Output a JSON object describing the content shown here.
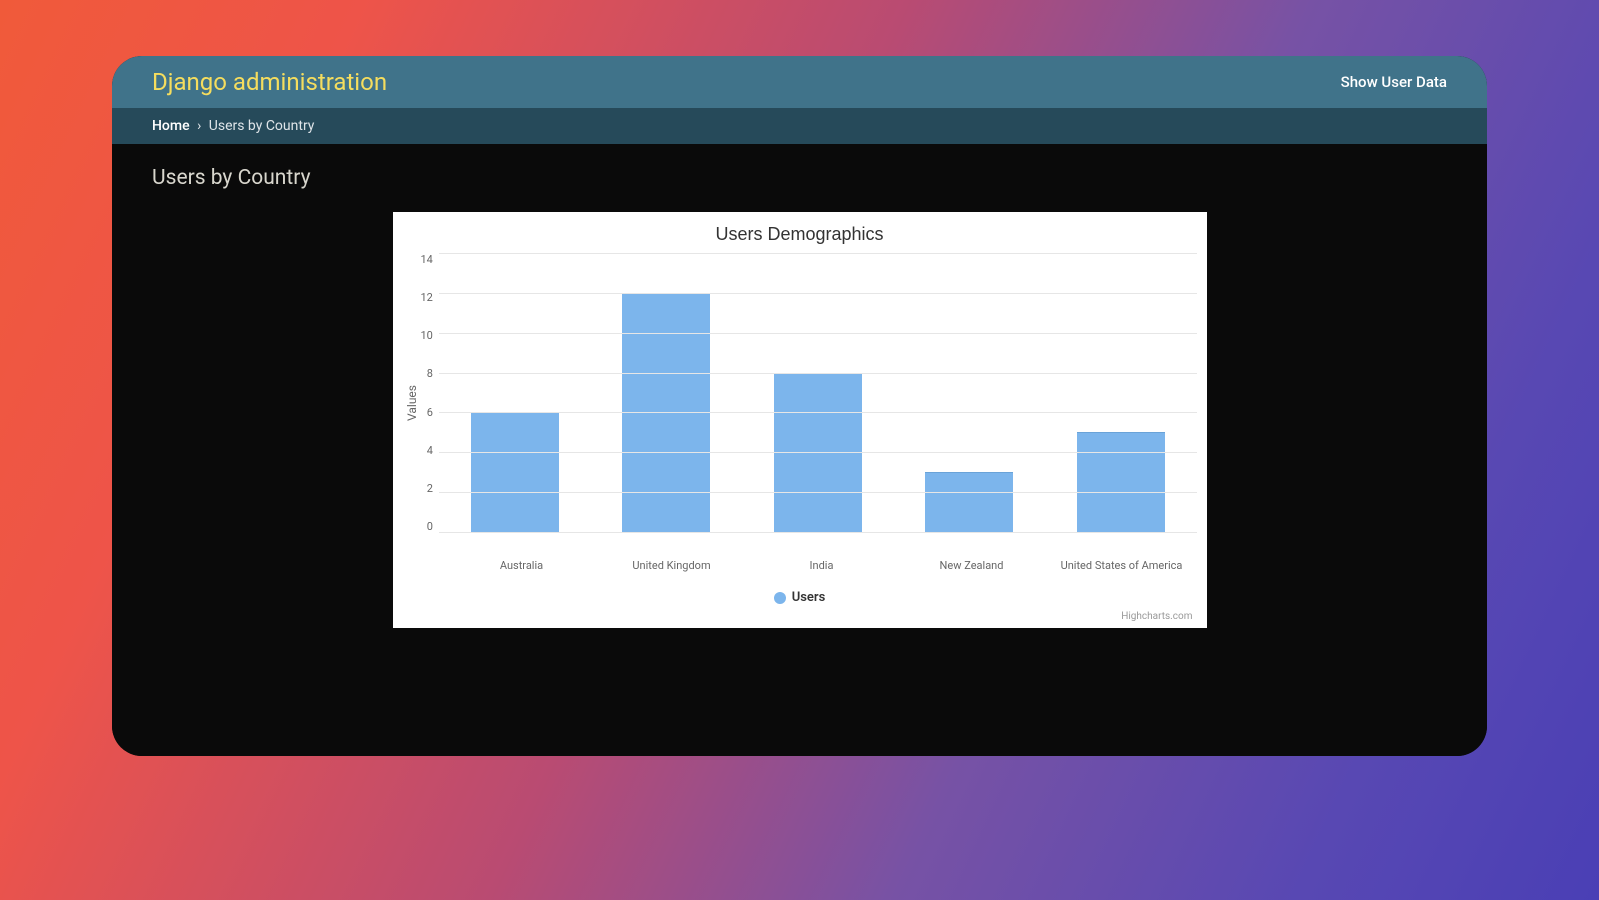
{
  "header": {
    "title": "Django administration",
    "user_link": "Show User Data"
  },
  "breadcrumb": {
    "home": "Home",
    "separator": "›",
    "current": "Users by Country"
  },
  "page": {
    "title": "Users by Country"
  },
  "chart_data": {
    "type": "bar",
    "title": "Users Demographics",
    "xlabel": "",
    "ylabel": "Values",
    "categories": [
      "Australia",
      "United Kingdom",
      "India",
      "New Zealand",
      "United States of America"
    ],
    "series": [
      {
        "name": "Users",
        "values": [
          6,
          12,
          8,
          3,
          5
        ]
      }
    ],
    "ylim": [
      0,
      14
    ],
    "yticks": [
      0,
      2,
      4,
      6,
      8,
      10,
      12,
      14
    ],
    "legend_position": "bottom",
    "credit": "Highcharts.com",
    "bar_color": "#7cb5ec"
  }
}
